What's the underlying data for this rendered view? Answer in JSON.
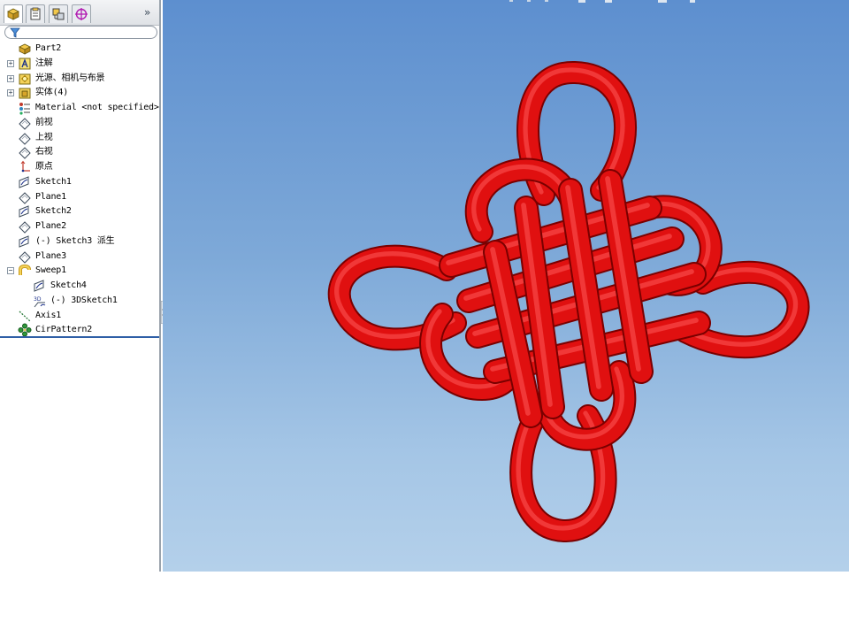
{
  "panel": {
    "tabs": [
      {
        "icon": "featuremanager-tree-icon",
        "active": true
      },
      {
        "icon": "propertymanager-icon",
        "active": false
      },
      {
        "icon": "configurationmanager-icon",
        "active": false
      },
      {
        "icon": "dimxpertmanager-icon",
        "active": false
      }
    ],
    "more_glyph": "»",
    "filter_icon": "filter-funnel-icon",
    "tree": [
      {
        "label": "Part2",
        "icon": "part-icon",
        "expandable": false
      },
      {
        "label": "注解",
        "icon": "annotations-icon",
        "expandable": true
      },
      {
        "label": "光源、相机与布景",
        "icon": "lights-cameras-scene-icon",
        "expandable": true
      },
      {
        "label": "实体(4)",
        "icon": "solid-bodies-icon",
        "expandable": true
      },
      {
        "label": "Material <not specified>",
        "icon": "material-icon",
        "expandable": false
      },
      {
        "label": "前视",
        "icon": "plane-icon",
        "expandable": false
      },
      {
        "label": "上视",
        "icon": "plane-icon",
        "expandable": false
      },
      {
        "label": "右视",
        "icon": "plane-icon",
        "expandable": false
      },
      {
        "label": "原点",
        "icon": "origin-icon",
        "expandable": false
      },
      {
        "label": "Sketch1",
        "icon": "sketch-icon",
        "expandable": false
      },
      {
        "label": "Plane1",
        "icon": "plane-icon",
        "expandable": false
      },
      {
        "label": "Sketch2",
        "icon": "sketch-icon",
        "expandable": false
      },
      {
        "label": "Plane2",
        "icon": "plane-icon",
        "expandable": false
      },
      {
        "label": "(-) Sketch3 派生",
        "icon": "sketch-icon",
        "expandable": false
      },
      {
        "label": "Plane3",
        "icon": "plane-icon",
        "expandable": false
      },
      {
        "label": "Sweep1",
        "icon": "sweep-icon",
        "expandable": true,
        "expanded": true
      },
      {
        "label": "Sketch4",
        "icon": "sketch-icon",
        "expandable": false,
        "child": true
      },
      {
        "label": "(-) 3DSketch1",
        "icon": "3dsketch-icon",
        "expandable": false,
        "child": true
      },
      {
        "label": "Axis1",
        "icon": "axis-icon",
        "expandable": false
      },
      {
        "label": "CirPattern2",
        "icon": "circular-pattern-icon",
        "expandable": false
      }
    ]
  },
  "viewport": {
    "model_icon": "chinese-knot-model",
    "model_color": "#e01010",
    "background_top": "#5d8fcf",
    "background_bottom": "#b4d0ea"
  }
}
